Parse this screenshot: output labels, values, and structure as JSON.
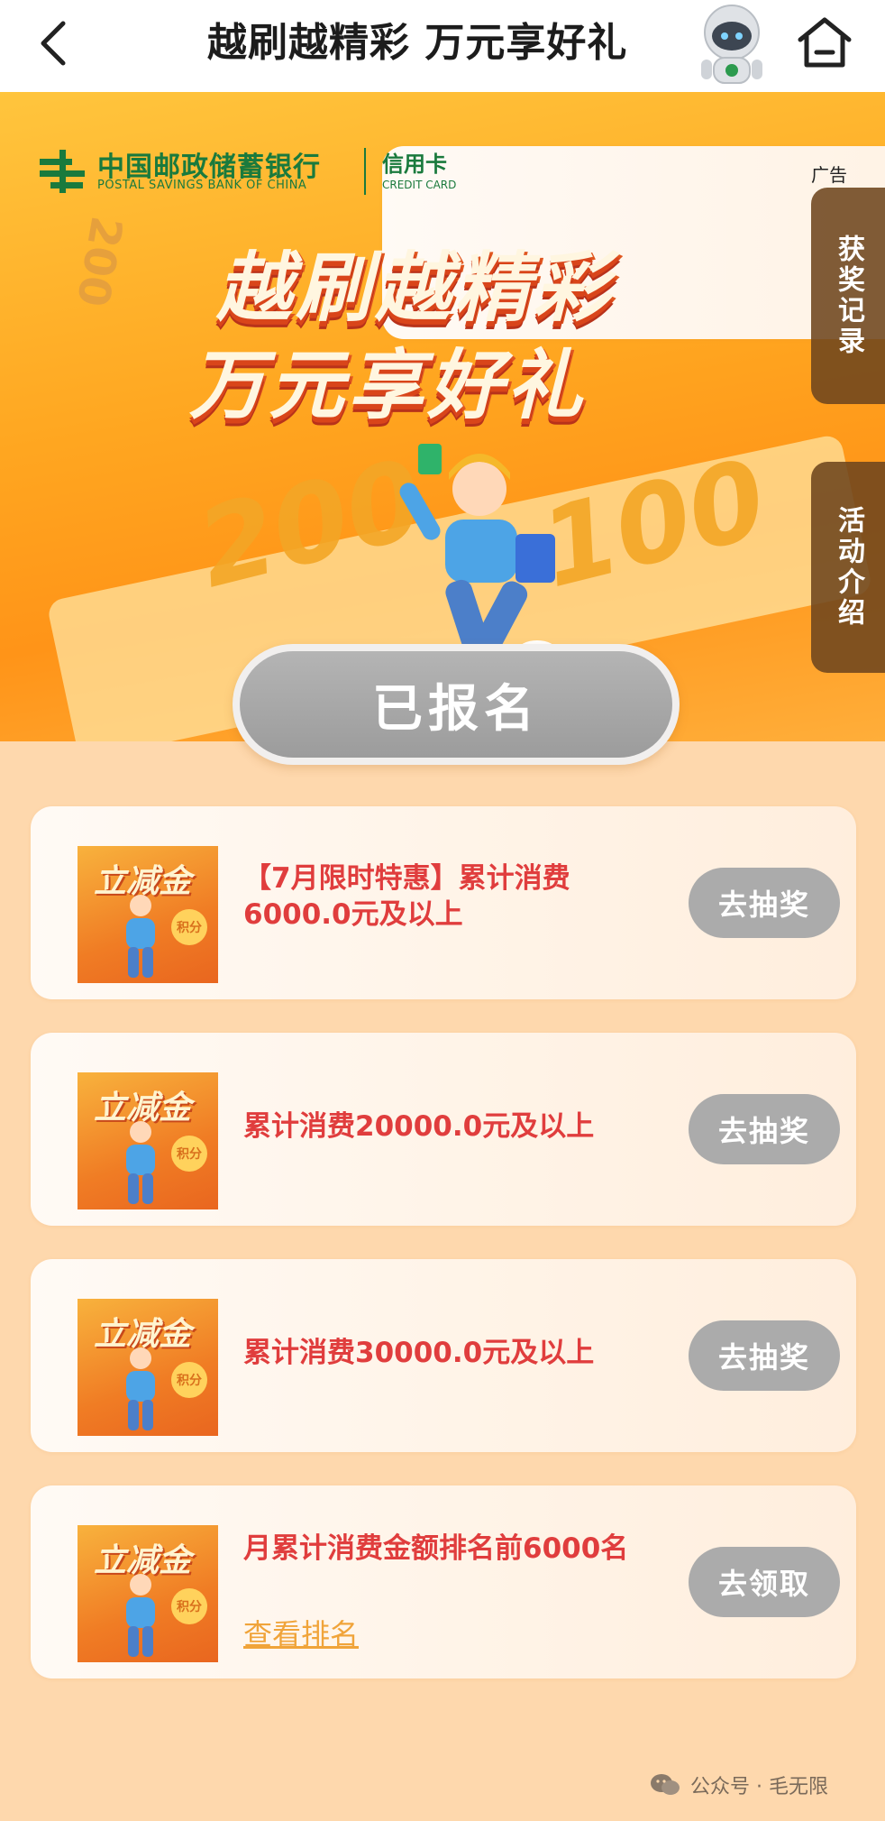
{
  "nav": {
    "title": "越刷越精彩 万元享好礼"
  },
  "banner": {
    "bank_name_cn": "中国邮政储蓄银行",
    "bank_name_en": "POSTAL SAVINGS BANK OF CHINA",
    "card_cn": "信用卡",
    "card_en": "CREDIT CARD",
    "ad_label": "广告",
    "slogan_line1": "越刷越精彩",
    "slogan_line2": "万元享好礼",
    "ticket_value_1": "200",
    "ticket_value_2": "100",
    "ticket_value_small": "200"
  },
  "side_tabs": [
    {
      "label": "获奖记录"
    },
    {
      "label": "活动介绍"
    }
  ],
  "registration": {
    "status_label": "已报名"
  },
  "tasks": [
    {
      "thumb_title": "立减金",
      "thumb_badge": "积分",
      "label": "【7月限时特惠】累计消费6000.0元及以上",
      "action": "去抽奖"
    },
    {
      "thumb_title": "立减金",
      "thumb_badge": "积分",
      "label": "累计消费20000.0元及以上",
      "action": "去抽奖"
    },
    {
      "thumb_title": "立减金",
      "thumb_badge": "积分",
      "label": "累计消费30000.0元及以上",
      "action": "去抽奖"
    },
    {
      "thumb_title": "立减金",
      "thumb_badge": "积分",
      "label": "月累计消费金额排名前6000名",
      "link": "查看排名",
      "action": "去领取"
    }
  ],
  "footer": {
    "watermark": "公众号 · 毛无限"
  },
  "colors": {
    "page_bg": "#fed8ad",
    "task_text": "#e03d3d",
    "action_button": "#ababab",
    "link": "#f0a43a",
    "brand_green": "#1a7a3d"
  }
}
